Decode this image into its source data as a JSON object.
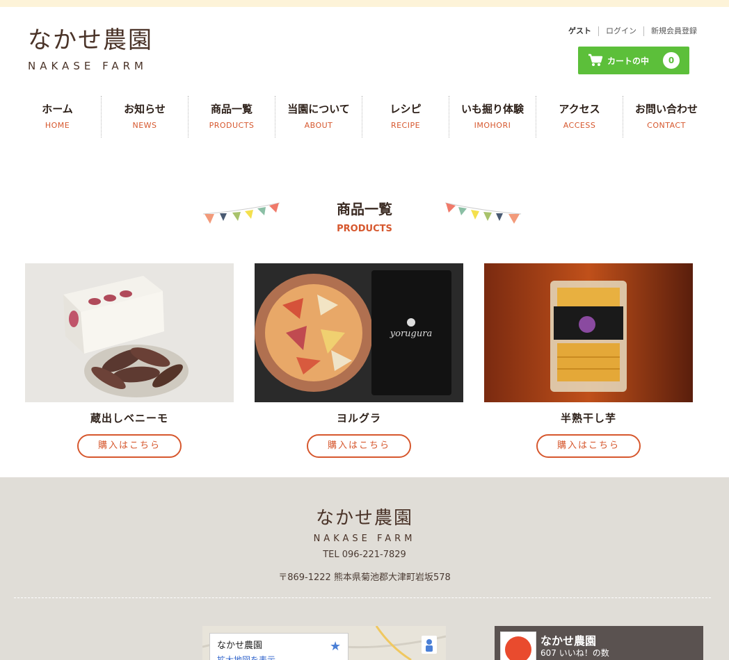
{
  "header": {
    "logo_jp": "なかせ農園",
    "logo_en": "NAKASE FARM",
    "account": [
      "ゲスト",
      "ログイン",
      "新規会員登録"
    ],
    "cart_label": "カートの中",
    "cart_count": "0"
  },
  "nav": [
    {
      "jp": "ホーム",
      "en": "HOME"
    },
    {
      "jp": "お知らせ",
      "en": "NEWS"
    },
    {
      "jp": "商品一覧",
      "en": "PRODUCTS"
    },
    {
      "jp": "当園について",
      "en": "ABOUT"
    },
    {
      "jp": "レシピ",
      "en": "RECIPE"
    },
    {
      "jp": "いも掘り体験",
      "en": "IMOHORI"
    },
    {
      "jp": "アクセス",
      "en": "ACCESS"
    },
    {
      "jp": "お問い合わせ",
      "en": "CONTACT"
    }
  ],
  "section": {
    "title_jp": "商品一覧",
    "title_en": "PRODUCTS"
  },
  "products": [
    {
      "name": "蔵出しベニーモ",
      "button": "購入はこちら"
    },
    {
      "name": "ヨルグラ",
      "button": "購入はこちら"
    },
    {
      "name": "半熟干し芋",
      "button": "購入はこちら"
    }
  ],
  "footer": {
    "logo_jp": "なかせ農園",
    "logo_en": "NAKASE FARM",
    "tel": "TEL 096-221-7829",
    "address": "〒869-1222 熊本県菊池郡大津町岩坂578",
    "map_title": "なかせ農園",
    "map_link": "拡大地図を表示",
    "fb_title": "なかせ農園",
    "fb_likes": "607 いいね！の数"
  },
  "colors": {
    "accent": "#d6572d",
    "cart": "#5cbf3a",
    "footer_bg": "#e0ddd7",
    "topbar": "#fdf3d8"
  }
}
